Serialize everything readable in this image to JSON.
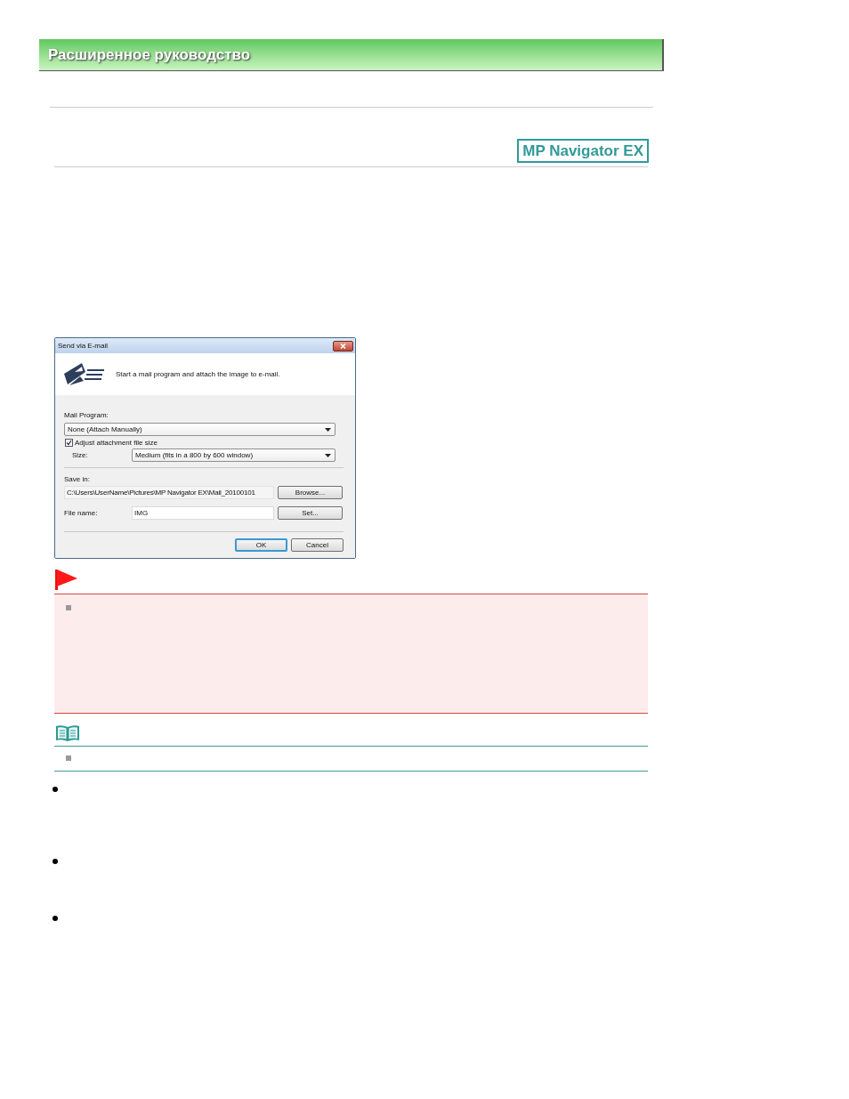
{
  "header": {
    "title": "Расширенное руководство"
  },
  "product_badge": {
    "label": "MP Navigator EX"
  },
  "dialog": {
    "title": "Send via E-mail",
    "description": "Start a mail program and attach the image to e-mail.",
    "mail_program": {
      "label": "Mail Program:",
      "value": "None (Attach Manually)"
    },
    "adjust_size": {
      "label": "Adjust attachment file size",
      "checked": true
    },
    "size": {
      "label": "Size:",
      "value": "Medium (fits in a 800 by 600 window)"
    },
    "save_in": {
      "label": "Save in:",
      "value": "C:\\Users\\UserName\\Pictures\\MP Navigator EX\\Mail_20100101",
      "button": "Browse..."
    },
    "file_name": {
      "label": "File name:",
      "value": "IMG",
      "button": "Set..."
    },
    "buttons": [
      {
        "label": "OK",
        "default": true
      },
      {
        "label": "Cancel",
        "default": false
      }
    ]
  }
}
